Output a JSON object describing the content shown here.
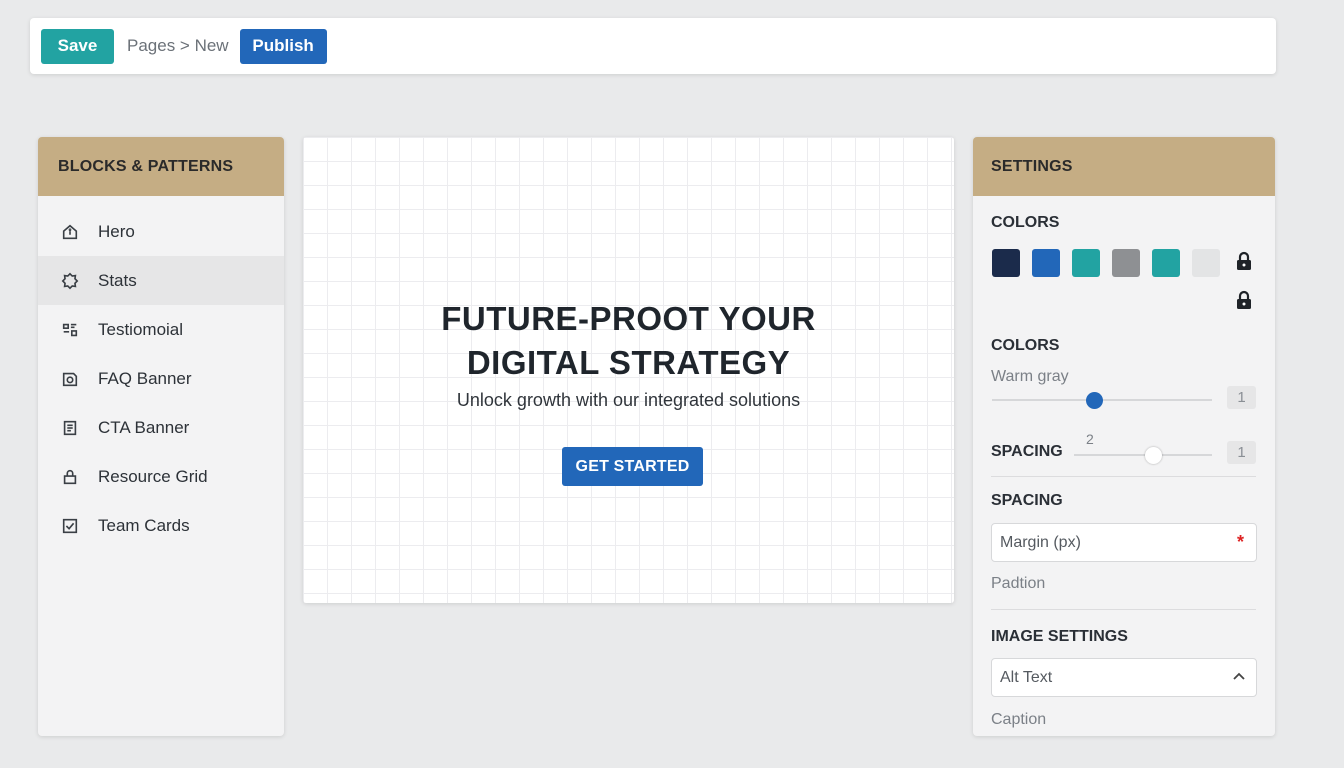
{
  "toolbar": {
    "save_label": "Save",
    "breadcrumb": "Pages > New",
    "publish_label": "Publish"
  },
  "left_panel": {
    "title": "BLOCKS & PATTERNS",
    "items": [
      {
        "label": "Hero",
        "icon": "home-icon"
      },
      {
        "label": "Stats",
        "icon": "badge-icon"
      },
      {
        "label": "Testiomoial",
        "icon": "quote-icon"
      },
      {
        "label": "FAQ Banner",
        "icon": "image-icon"
      },
      {
        "label": "CTA Banner",
        "icon": "list-icon"
      },
      {
        "label": "Resource Grid",
        "icon": "lock-icon"
      },
      {
        "label": "Team Cards",
        "icon": "checkbox-icon"
      }
    ],
    "active_index": 1
  },
  "canvas": {
    "title_line1": "FUTURE-PROOT YOUR",
    "title_line2": "DIGITAL STRATEGY",
    "subtitle": "Unlock growth with our integrated solutions",
    "cta_label": "GET STARTED"
  },
  "settings": {
    "title": "SETTINGS",
    "colors_label": "COLORS",
    "swatches": [
      "#1b2b4b",
      "#2267b9",
      "#22a3a2",
      "#8e9093",
      "#22a3a2",
      "#e3e4e5"
    ],
    "colors2_label": "COLORS",
    "warm_gray_label": "Warm gray",
    "warm_gray_value": "1",
    "spacing_slider_label": "SPACING",
    "spacing_slider_hint": "2",
    "spacing_value": "1",
    "spacing_label": "SPACING",
    "margin_placeholder": "Margin (px)",
    "padding_label": "Padtion",
    "image_settings_label": "IMAGE SETTINGS",
    "alt_text_placeholder": "Alt Text",
    "caption_label": "Caption"
  },
  "colors": {
    "accent_teal": "#22a3a2",
    "accent_blue": "#2267b9",
    "panel_header": "#c5ad84"
  }
}
